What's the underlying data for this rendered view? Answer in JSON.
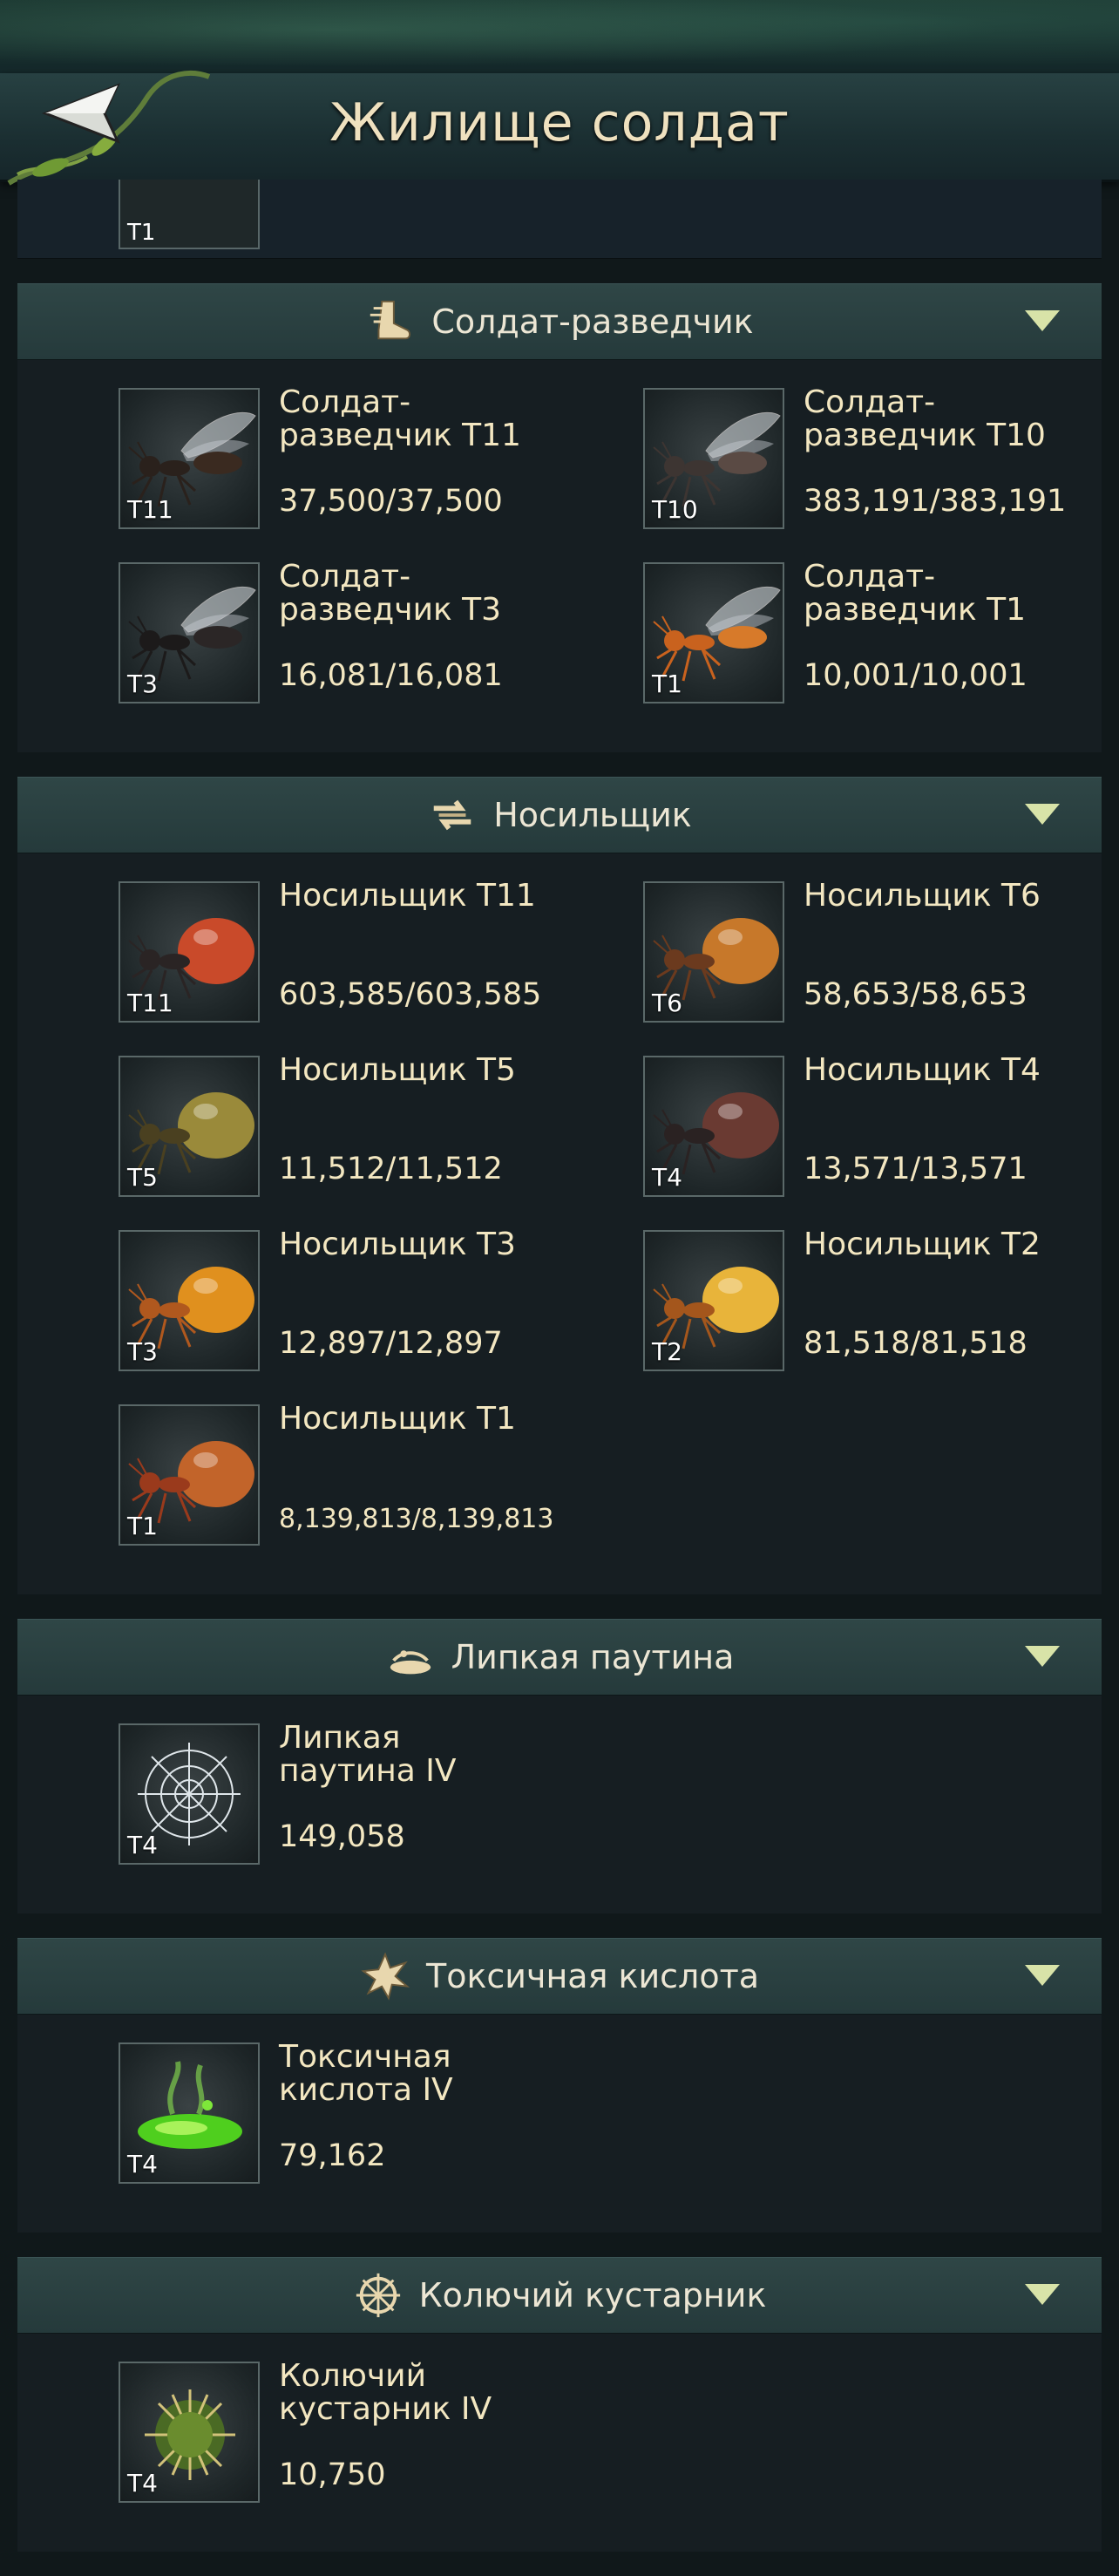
{
  "header": {
    "title": "Жилище солдат"
  },
  "partial": {
    "tier": "T1"
  },
  "sections": [
    {
      "title": "Солдат-разведчик",
      "icon": "boot-icon",
      "items": [
        {
          "name": "Солдат-разведчик T11",
          "tier": "T11",
          "count": "37,500/37,500",
          "image": "winged-ant-dark"
        },
        {
          "name": "Солдат-разведчик T10",
          "tier": "T10",
          "count": "383,191/383,191",
          "image": "winged-ant-gray"
        },
        {
          "name": "Солдат-разведчик T3",
          "tier": "T3",
          "count": "16,081/16,081",
          "image": "winged-ant-black"
        },
        {
          "name": "Солдат-разведчик T1",
          "tier": "T1",
          "count": "10,001/10,001",
          "image": "winged-ant-orange"
        }
      ]
    },
    {
      "title": "Носильщик",
      "icon": "arrows-icon",
      "items": [
        {
          "name": "Носильщик T11",
          "tier": "T11",
          "count": "603,585/603,585",
          "image": "honeypot-red"
        },
        {
          "name": "Носильщик T6",
          "tier": "T6",
          "count": "58,653/58,653",
          "image": "honeypot-amber"
        },
        {
          "name": "Носильщик T5",
          "tier": "T5",
          "count": "11,512/11,512",
          "image": "honeypot-olive"
        },
        {
          "name": "Носильщик T4",
          "tier": "T4",
          "count": "13,571/13,571",
          "image": "honeypot-dark"
        },
        {
          "name": "Носильщик T3",
          "tier": "T3",
          "count": "12,897/12,897",
          "image": "honeypot-orange"
        },
        {
          "name": "Носильщик T2",
          "tier": "T2",
          "count": "81,518/81,518",
          "image": "honeypot-yellow"
        },
        {
          "name": "Носильщик T1",
          "tier": "T1",
          "count": "8,139,813/8,139,813",
          "image": "honeypot-rust"
        }
      ]
    },
    {
      "title": "Липкая паутина",
      "icon": "web-pile-icon",
      "items": [
        {
          "name": "Липкая паутина IV",
          "tier": "T4",
          "count": "149,058",
          "image": "spider-web"
        }
      ]
    },
    {
      "title": "Токсичная кислота",
      "icon": "splat-icon",
      "items": [
        {
          "name": "Токсичная кислота IV",
          "tier": "T4",
          "count": "79,162",
          "image": "acid-puddle"
        }
      ]
    },
    {
      "title": "Колючий кустарник",
      "icon": "thorn-icon",
      "items": [
        {
          "name": "Колючий кустарник IV",
          "tier": "T4",
          "count": "10,750",
          "image": "thorn-bush"
        }
      ]
    }
  ],
  "colors": {
    "text": "#f3e7c1",
    "header_text": "#efe1bf",
    "toggle": "#d8e3a8",
    "section_bg": "#161e22"
  }
}
